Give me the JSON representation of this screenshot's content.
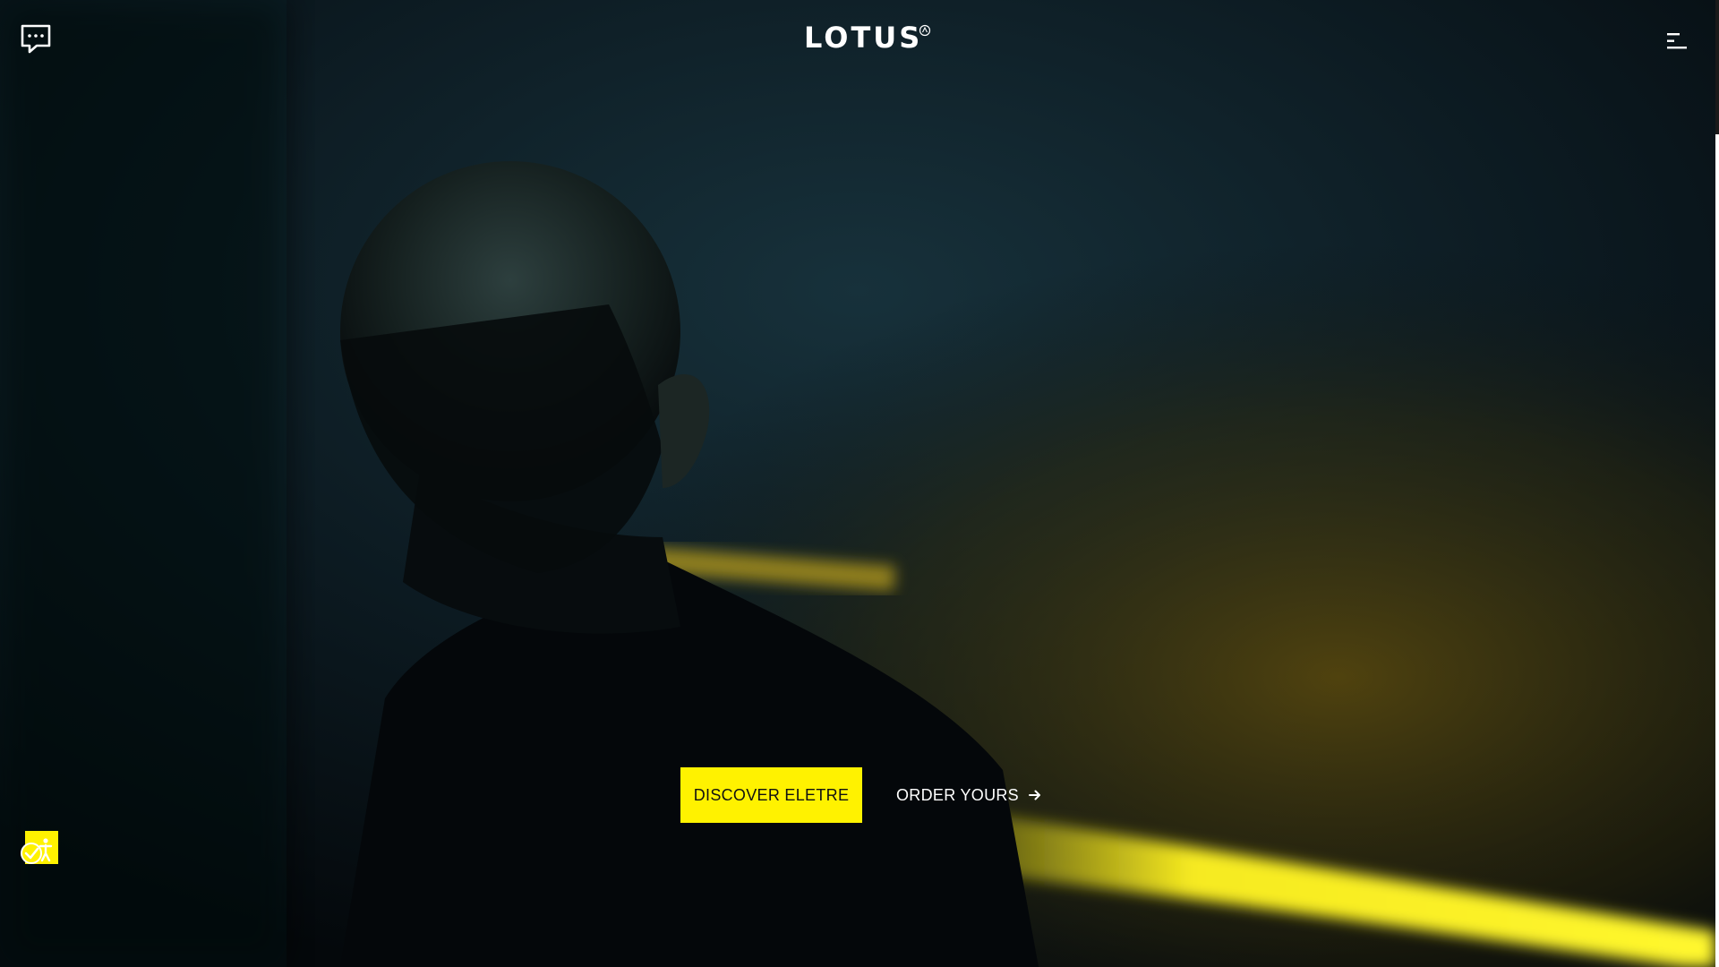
{
  "header": {
    "logo_text": "LOTUS",
    "chat_icon": "chat-bubble-icon",
    "menu_icon": "hamburger-menu-icon"
  },
  "hero": {
    "primary_cta": "DISCOVER ELETRE",
    "secondary_cta": "ORDER YOURS",
    "secondary_icon": "arrow-right-icon"
  },
  "accessibility": {
    "icon": "accessibility-icon"
  },
  "colors": {
    "accent": "#fff200",
    "background": "#05090d",
    "text": "#ffffff"
  }
}
